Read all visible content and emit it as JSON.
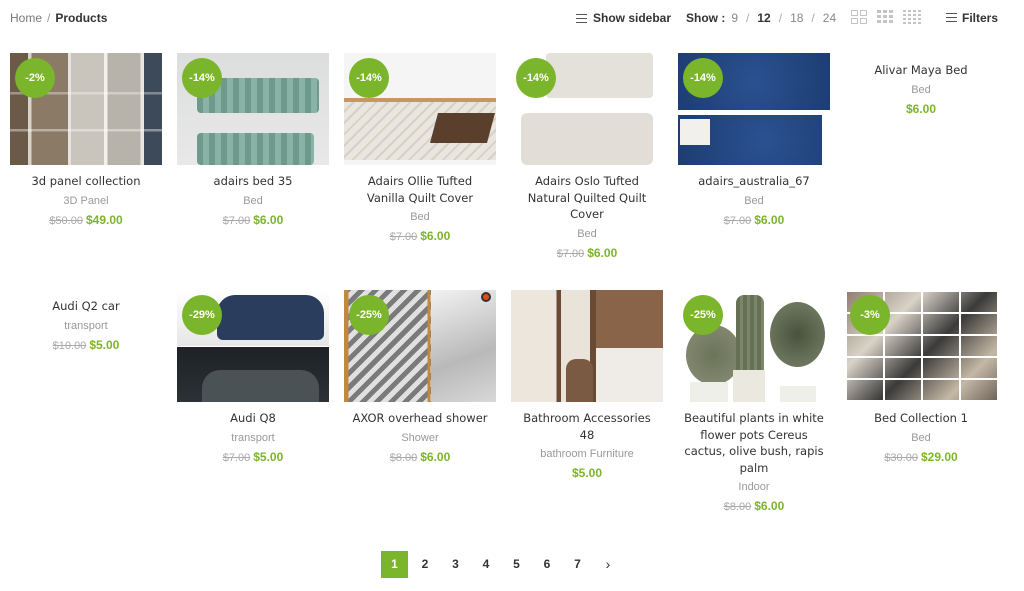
{
  "breadcrumb": {
    "home": "Home",
    "separator": "/",
    "current": "Products"
  },
  "toolbar": {
    "show_sidebar": "Show sidebar",
    "show_label": "Show :",
    "per_page_options": [
      "9",
      "12",
      "18",
      "24"
    ],
    "per_page_active": "12",
    "filters": "Filters"
  },
  "theme": {
    "accent": "#7bb52b"
  },
  "products": [
    {
      "title": "3d panel collection",
      "category": "3D Panel",
      "old_price": "$50.00",
      "price": "$49.00",
      "badge": "-2%",
      "has_image": true
    },
    {
      "title": "adairs bed 35",
      "category": "Bed",
      "old_price": "$7.00",
      "price": "$6.00",
      "badge": "-14%",
      "has_image": true
    },
    {
      "title": "Adairs Ollie Tufted Vanilla Quilt Cover",
      "category": "Bed",
      "old_price": "$7.00",
      "price": "$6.00",
      "badge": "-14%",
      "has_image": true
    },
    {
      "title": "Adairs Oslo Tufted Natural Quilted Quilt Cover",
      "category": "Bed",
      "old_price": "$7.00",
      "price": "$6.00",
      "badge": "-14%",
      "has_image": true
    },
    {
      "title": "adairs_australia_67",
      "category": "Bed",
      "old_price": "$7.00",
      "price": "$6.00",
      "badge": "-14%",
      "has_image": true
    },
    {
      "title": "Alivar Maya Bed",
      "category": "Bed",
      "old_price": "",
      "price": "$6.00",
      "badge": "",
      "has_image": false
    },
    {
      "title": "Audi Q2 car",
      "category": "transport",
      "old_price": "$10.00",
      "price": "$5.00",
      "badge": "",
      "has_image": false
    },
    {
      "title": "Audi Q8",
      "category": "transport",
      "old_price": "$7.00",
      "price": "$5.00",
      "badge": "-29%",
      "has_image": true
    },
    {
      "title": "AXOR overhead shower",
      "category": "Shower",
      "old_price": "$8.00",
      "price": "$6.00",
      "badge": "-25%",
      "has_image": true
    },
    {
      "title": "Bathroom Accessories 48",
      "category": "bathroom Furniture",
      "old_price": "",
      "price": "$5.00",
      "badge": "",
      "has_image": true
    },
    {
      "title": "Beautiful plants in white flower pots Cereus cactus, olive bush, rapis palm",
      "category": "Indoor",
      "old_price": "$8.00",
      "price": "$6.00",
      "badge": "-25%",
      "has_image": true
    },
    {
      "title": "Bed Collection 1",
      "category": "Bed",
      "old_price": "$30.00",
      "price": "$29.00",
      "badge": "-3%",
      "has_image": true
    }
  ],
  "pagination": {
    "pages": [
      "1",
      "2",
      "3",
      "4",
      "5",
      "6",
      "7"
    ],
    "active": "1",
    "next": "›"
  }
}
